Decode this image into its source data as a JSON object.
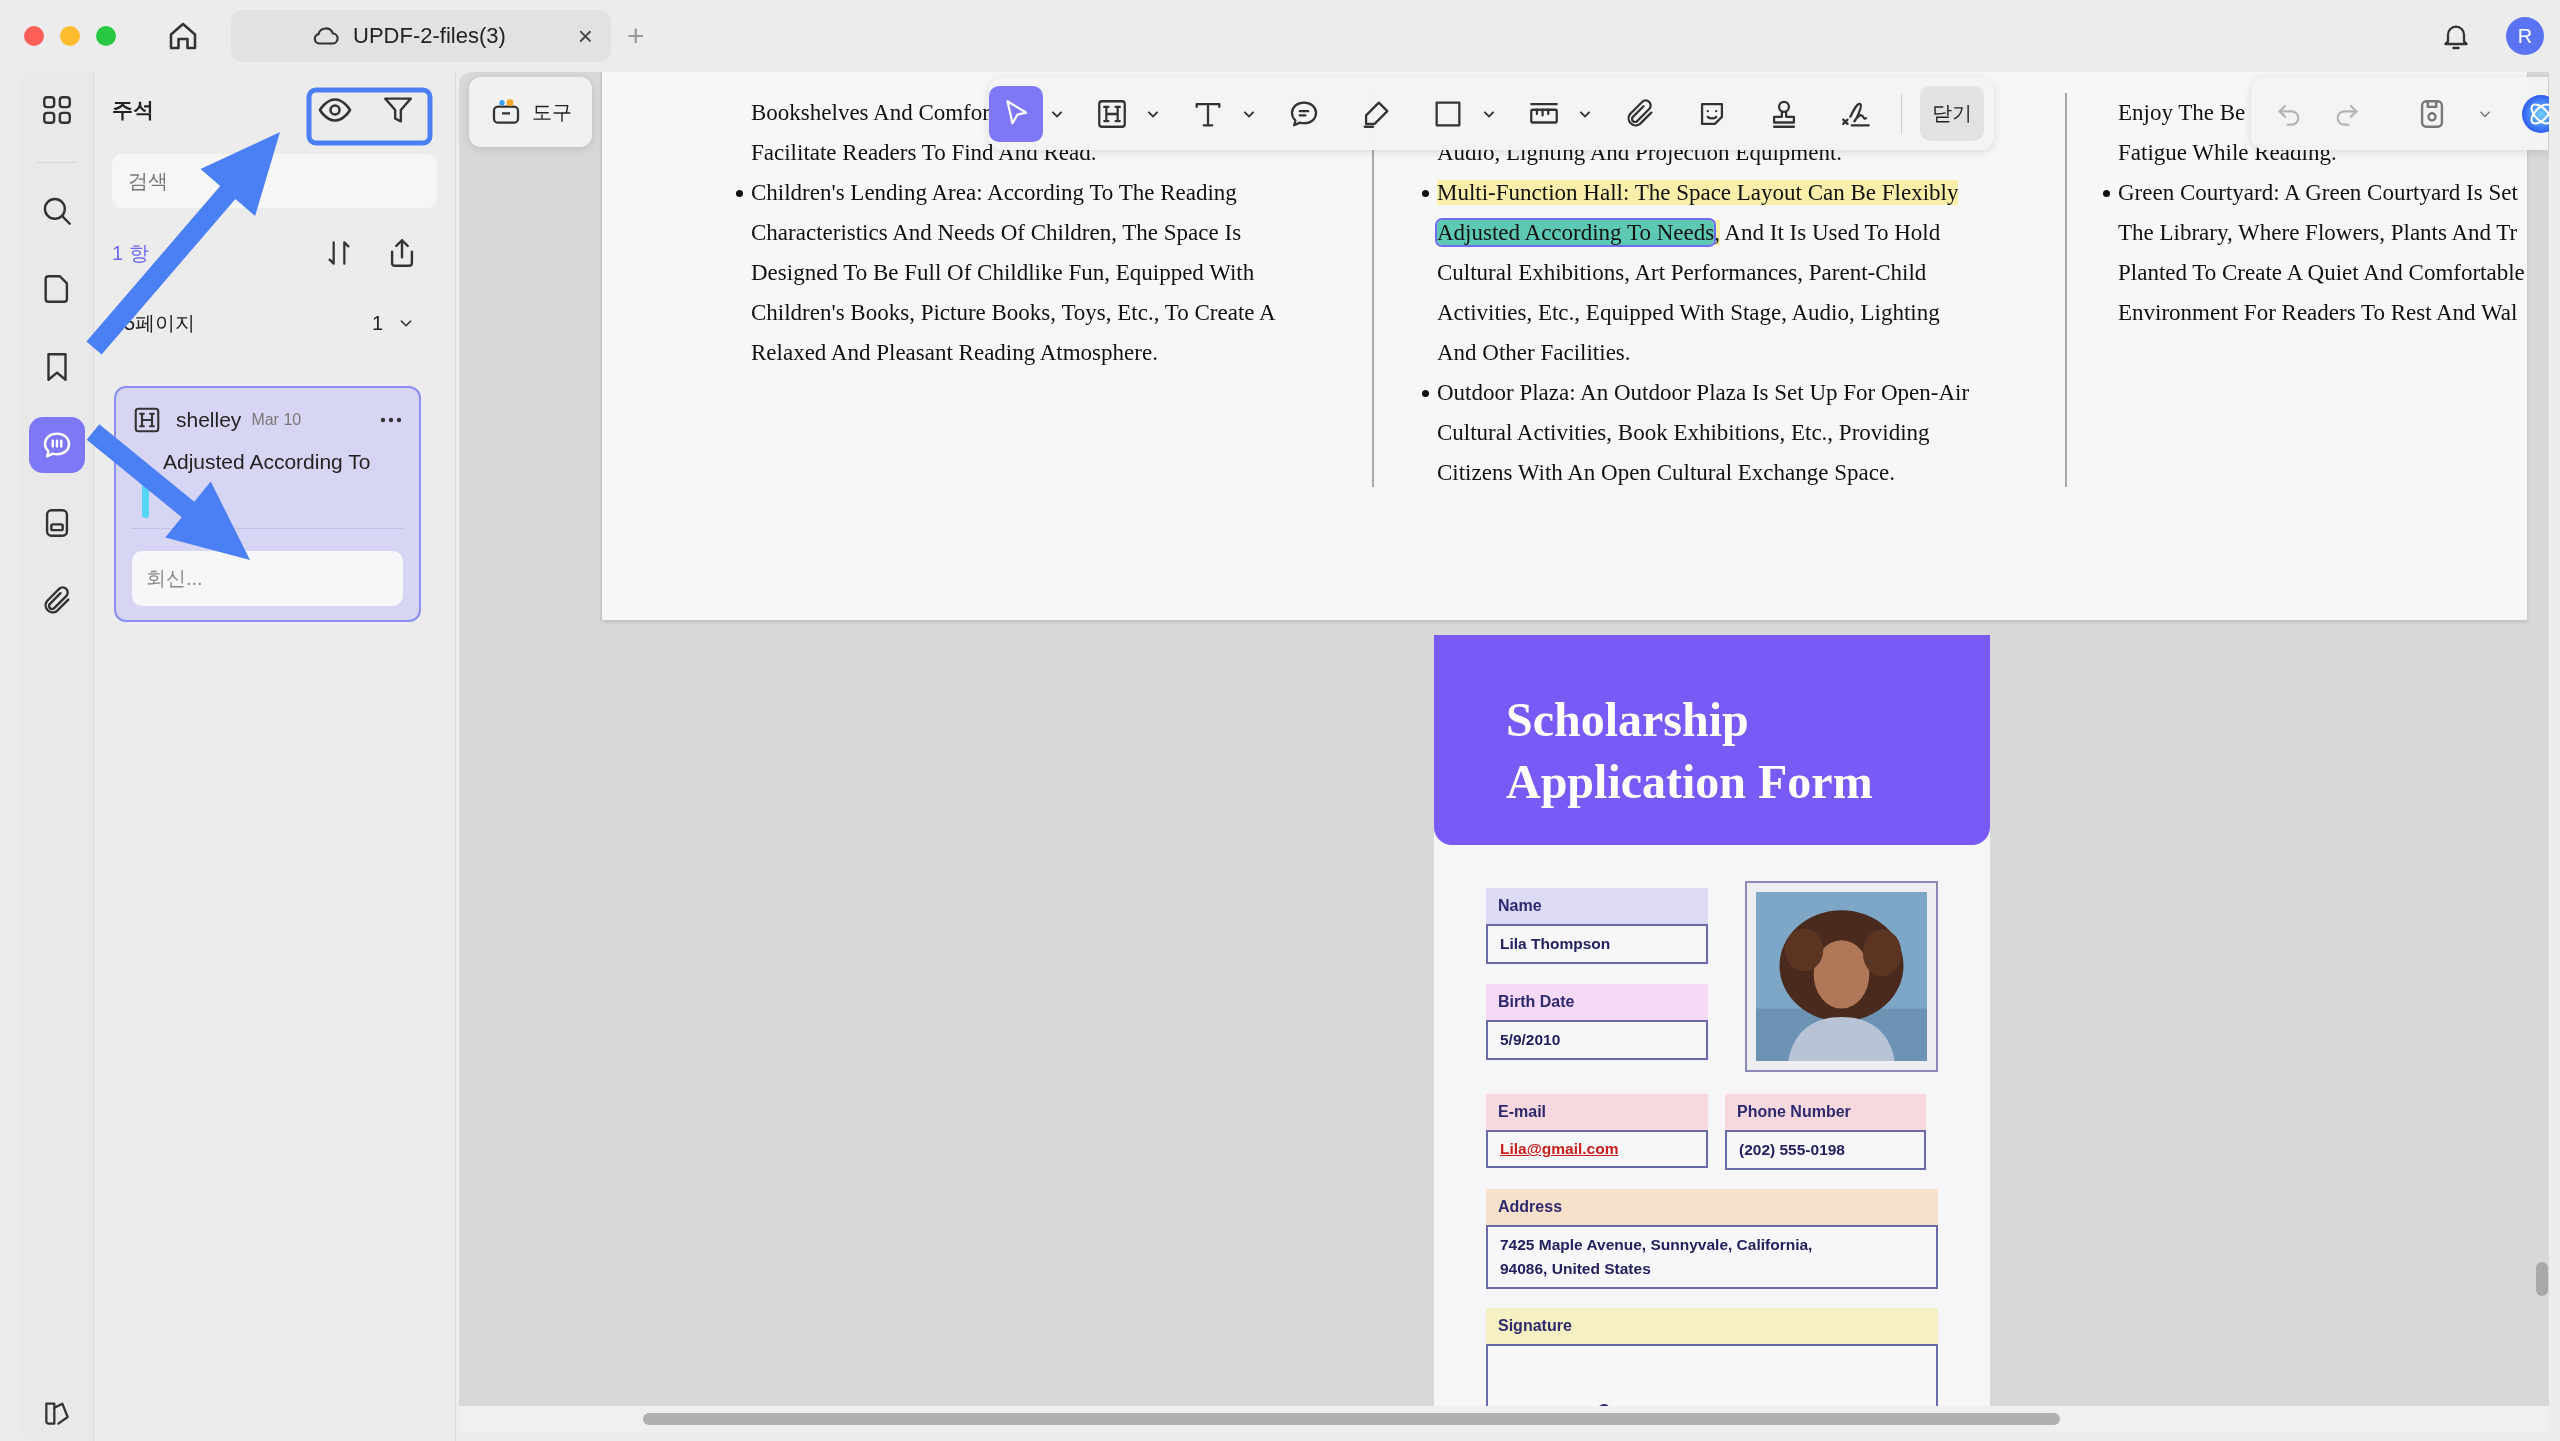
{
  "window": {
    "tab_title": "UPDF-2-files(3)",
    "close_tab": "×",
    "new_tab": "+",
    "avatar": "R"
  },
  "rail": {
    "items": [
      {
        "selected": false
      },
      {
        "selected": false
      },
      {
        "selected": false
      },
      {
        "selected": false
      },
      {
        "selected": true
      },
      {
        "selected": false
      },
      {
        "selected": false
      }
    ]
  },
  "panel": {
    "title": "주석",
    "search": {
      "placeholder": "검색"
    },
    "count": "1 항",
    "page_group": {
      "label": "5페이지",
      "count": "1",
      "expanded": true
    },
    "comments": [
      {
        "author": "shelley",
        "date": "Mar 10",
        "quote": "Adjusted According To",
        "reply": {
          "placeholder": "회신..."
        }
      }
    ]
  },
  "tools_button": "도구",
  "toolbar": {
    "tools": [
      {
        "selected": true,
        "menu": true
      },
      {
        "selected": false,
        "menu": true
      },
      {
        "selected": false,
        "menu": true
      },
      {
        "selected": false,
        "menu": false
      },
      {
        "selected": false,
        "menu": false
      },
      {
        "selected": false,
        "menu": true
      },
      {
        "selected": false,
        "menu": true
      },
      {
        "selected": false,
        "menu": false
      },
      {
        "selected": false,
        "menu": false
      },
      {
        "selected": false,
        "menu": false
      },
      {
        "selected": false,
        "menu": false
      }
    ],
    "close": "닫기"
  },
  "history": {
    "undo": {
      "disabled": true
    },
    "redo": {
      "disabled": true
    }
  },
  "document": {
    "columns": [
      {
        "paragraphs": [
          {
            "bullet": false,
            "lines": [
              "Bookshelves And Comfor",
              "Facilitate Readers To Find And Read."
            ]
          },
          {
            "bullet": true,
            "lines": [
              "Children's Lending Area: According To The Reading",
              "Characteristics And Needs Of Children, The Space Is",
              "Designed To Be Full Of Childlike Fun, Equipped With",
              "Children's Books, Picture Books, Toys, Etc., To Create A",
              "Relaxed And Pleasant Reading Atmosphere."
            ]
          }
        ]
      },
      {
        "paragraphs": [
          {
            "bullet": false,
            "lines": [
              "Audio, Lighting And Projection Equipment."
            ]
          },
          {
            "bullet": true,
            "lines": [
              [
                {
                  "text": "Multi-Function Hall: The Space Layout Can Be Flexibly",
                  "highlighted": true,
                  "selected": false
                }
              ],
              [
                {
                  "text": "Adjusted According To Needs",
                  "highlighted": true,
                  "selected": true
                },
                {
                  "text": ",",
                  "highlighted": true,
                  "selected": false
                },
                {
                  "text": " And It Is Used To Hold",
                  "highlighted": false,
                  "selected": false
                }
              ],
              "Cultural Exhibitions, Art Performances, Parent-Child",
              "Activities, Etc., Equipped With Stage, Audio, Lighting",
              "And Other Facilities."
            ]
          },
          {
            "bullet": true,
            "lines": [
              "Outdoor Plaza: An Outdoor Plaza Is Set Up For Open-Air",
              "Cultural Activities, Book Exhibitions, Etc., Providing",
              "Citizens With An Open Cultural Exchange Space."
            ]
          }
        ]
      },
      {
        "paragraphs": [
          {
            "bullet": false,
            "lines": [
              "Enjoy The Be",
              "Fatigue While Reading."
            ]
          },
          {
            "bullet": true,
            "lines": [
              "Green Courtyard: A Green Courtyard Is Set",
              "The Library, Where Flowers, Plants And Tr",
              "Planted To Create A Quiet And Comfortable",
              "Environment For Readers To Rest And Wal"
            ]
          }
        ]
      }
    ]
  },
  "form": {
    "title": "Scholarship Application Form",
    "fields": [
      {
        "label": "Name",
        "value": "Lila Thompson",
        "color": "#dcdaf5",
        "kind": "text"
      },
      {
        "label": "Birth Date",
        "value": "5/9/2010",
        "color": "#f6d9f6",
        "kind": "text"
      },
      {
        "label": "E-mail",
        "value": "Lila@gmail.com",
        "color": "#f6d8de",
        "kind": "link"
      },
      {
        "label": "Phone Number",
        "value": "(202) 555-0198",
        "color": "#f6d8de",
        "kind": "text"
      },
      {
        "label": "Address",
        "value": "7425 Maple Avenue, Sunnyvale, California, 94086, United States",
        "color": "#f7e1cb",
        "kind": "text"
      },
      {
        "label": "Signature",
        "color": "#f6f1c3",
        "kind": "signature"
      }
    ]
  }
}
